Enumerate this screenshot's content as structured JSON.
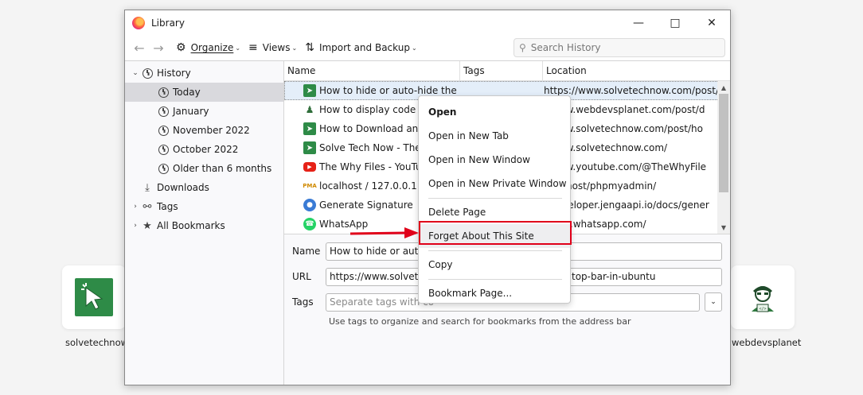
{
  "window": {
    "title": "Library"
  },
  "toolbar": {
    "organize": "Organize",
    "views": "Views",
    "import_backup": "Import and Backup",
    "search_placeholder": "Search History"
  },
  "sidebar": {
    "history": "History",
    "today": "Today",
    "january": "January",
    "november": "November 2022",
    "october": "October 2022",
    "older": "Older than 6 months",
    "downloads": "Downloads",
    "tags": "Tags",
    "all_bookmarks": "All Bookmarks"
  },
  "columns": {
    "name": "Name",
    "tags": "Tags",
    "location": "Location"
  },
  "rows": [
    {
      "name": "How to hide or auto-hide the t...",
      "location": "https://www.solvetechnow.com/post/ho"
    },
    {
      "name": "How to display code sn",
      "location": "//www.webdevsplanet.com/post/d"
    },
    {
      "name": "How to Download and s",
      "location": "//www.solvetechnow.com/post/ho"
    },
    {
      "name": "Solve Tech Now - The s",
      "location": "//www.solvetechnow.com/"
    },
    {
      "name": "The Why Files - YouTub",
      "location": "//www.youtube.com/@TheWhyFile"
    },
    {
      "name": "localhost / 127.0.0.1 | ph",
      "location": "localhost/phpmyadmin/"
    },
    {
      "name": "Generate Signature",
      "location": "//developer.jengaapi.io/docs/gener"
    },
    {
      "name": "WhatsApp",
      "location": "//web.whatsapp.com/"
    }
  ],
  "details": {
    "name_label": "Name",
    "name_value": "How to hide or auto-",
    "url_label": "URL",
    "url_value": "https://www.solvetec",
    "url_value_tail": "top-bar-in-ubuntu",
    "tags_label": "Tags",
    "tags_placeholder": "Separate tags with co",
    "hint": "Use tags to organize and search for bookmarks from the address bar"
  },
  "context_menu": {
    "open": "Open",
    "open_new_tab": "Open in New Tab",
    "open_new_window": "Open in New Window",
    "open_private": "Open in New Private Window",
    "delete_page": "Delete Page",
    "forget_site": "Forget About This Site",
    "copy": "Copy",
    "bookmark_page": "Bookmark Page..."
  },
  "background": {
    "left_caption": "solvetechnow",
    "right_caption": "webdevsplanet"
  },
  "colors": {
    "highlight": "#e0001a",
    "selection": "#e4eef9",
    "stn_green": "#2e8b47"
  }
}
